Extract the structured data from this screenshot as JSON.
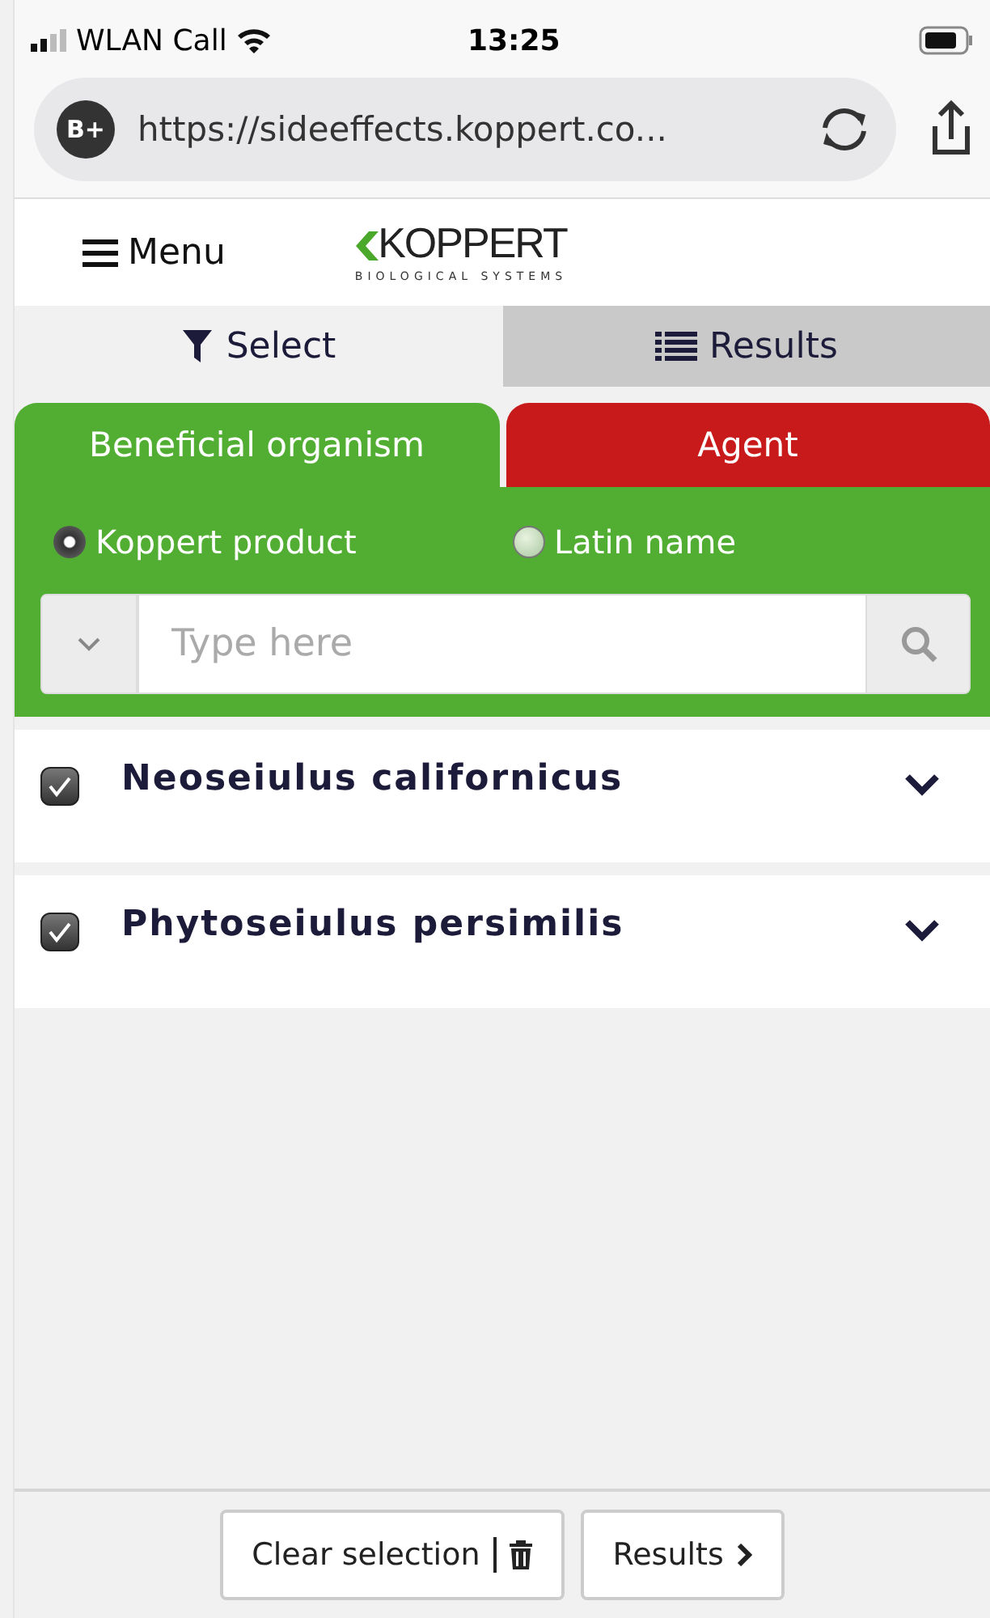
{
  "status_bar": {
    "carrier": "WLAN Call",
    "time": "13:25"
  },
  "browser": {
    "url": "https://sideeffects.koppert.co...",
    "badge": "B+"
  },
  "header": {
    "menu_label": "Menu",
    "logo_name": "KOPPERT",
    "logo_tagline": "BIOLOGICAL SYSTEMS"
  },
  "view_tabs": [
    {
      "label": "Select",
      "selected": true
    },
    {
      "label": "Results",
      "selected": false
    }
  ],
  "category_tabs": [
    {
      "label": "Beneficial organism",
      "color": "#52ae32",
      "selected": true
    },
    {
      "label": "Agent",
      "color": "#c8191b",
      "selected": false
    }
  ],
  "name_options": [
    {
      "label": "Koppert product",
      "selected": true
    },
    {
      "label": "Latin name",
      "selected": false
    }
  ],
  "search": {
    "placeholder": "Type here"
  },
  "organisms": [
    {
      "name": "Neoseiulus californicus",
      "checked": true,
      "expanded": false
    },
    {
      "name": "Phytoseiulus persimilis",
      "checked": true,
      "expanded": false
    }
  ],
  "footer_buttons": [
    {
      "label": "Clear selection",
      "kind": "clear"
    },
    {
      "label": "Results",
      "kind": "next"
    }
  ]
}
